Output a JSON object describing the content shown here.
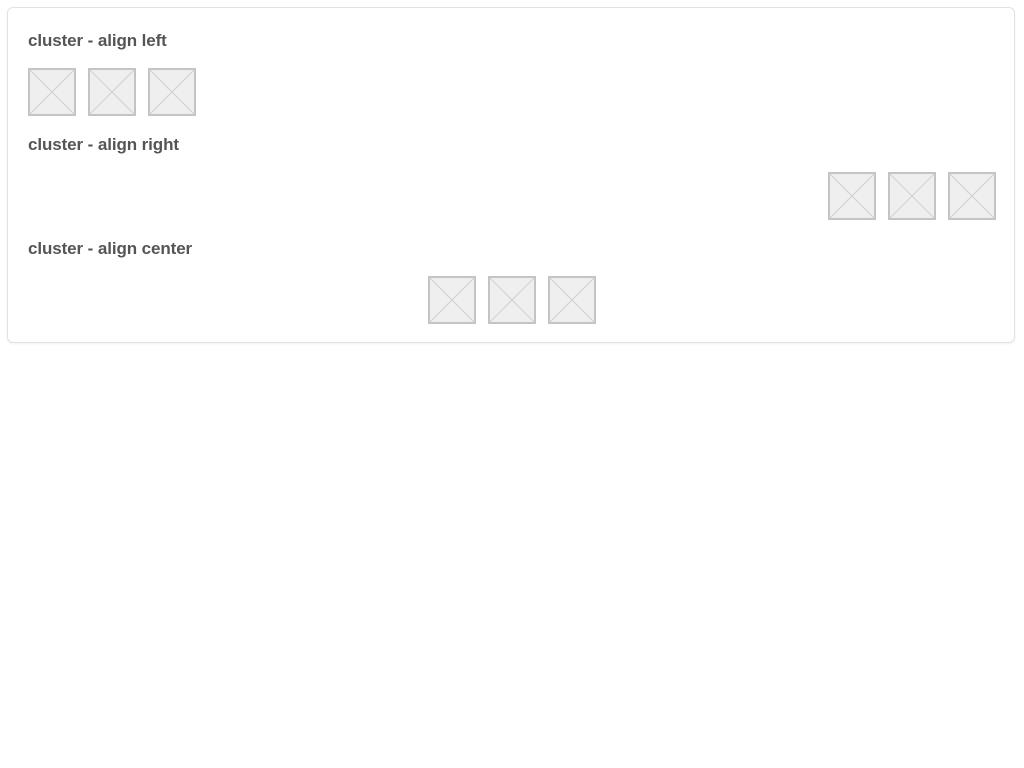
{
  "colors": {
    "text": "#555555",
    "placeholder_fill": "#efefef",
    "placeholder_border": "#c4c4c4",
    "panel_border": "#e2e2e2"
  },
  "sections": [
    {
      "title": "cluster - align left",
      "align": "left",
      "items": [
        {
          "icon": "image-placeholder-icon"
        },
        {
          "icon": "image-placeholder-icon"
        },
        {
          "icon": "image-placeholder-icon"
        }
      ]
    },
    {
      "title": "cluster - align right",
      "align": "right",
      "items": [
        {
          "icon": "image-placeholder-icon"
        },
        {
          "icon": "image-placeholder-icon"
        },
        {
          "icon": "image-placeholder-icon"
        }
      ]
    },
    {
      "title": "cluster - align center",
      "align": "center",
      "items": [
        {
          "icon": "image-placeholder-icon"
        },
        {
          "icon": "image-placeholder-icon"
        },
        {
          "icon": "image-placeholder-icon"
        }
      ]
    }
  ]
}
